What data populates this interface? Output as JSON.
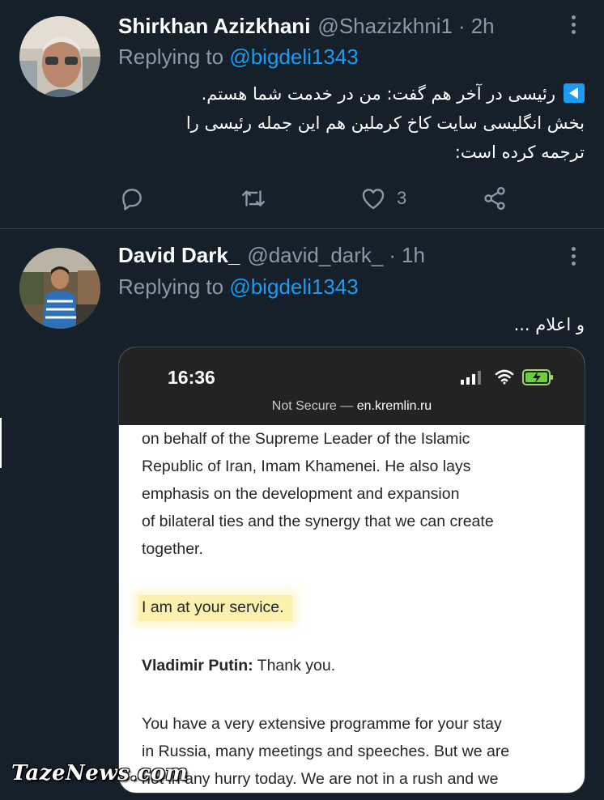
{
  "tweets": [
    {
      "name": "Shirkhan Azizkhani",
      "handle": "@Shazizkhni1",
      "separator": "·",
      "time": "2h",
      "replying_prefix": "Replying to",
      "replying_to": "@bigdeli1343",
      "text_line1": "رئیسی در آخر هم گفت: من در خدمت شما هستم.",
      "text_line2": "بخش انگلیسی سایت کاخ کرملین هم این جمله رئیسی را",
      "text_line3": "ترجمه کرده است:",
      "like_count": "3"
    },
    {
      "name": "David Dark_",
      "handle": "@david_dark_",
      "separator": "·",
      "time": "1h",
      "replying_prefix": "Replying to",
      "replying_to": "@bigdeli1343",
      "text": "و اعلام ..."
    }
  ],
  "embed": {
    "phone_time": "16:36",
    "url_prefix": "Not Secure —",
    "url_domain": "en.kremlin.ru",
    "para1_line1": "on behalf of the Supreme Leader of the Islamic",
    "para1_line2": "Republic of Iran, Imam Khamenei. He also lays",
    "para1_line3": "emphasis on the development and expansion",
    "para1_line4": "of bilateral ties and the synergy that we can create",
    "para1_line5": "together.",
    "highlight": "I am at your service.",
    "speaker": "Vladimir Putin:",
    "speaker_line": " Thank you.",
    "para3_line1": "You have a very extensive programme for your stay",
    "para3_line2": "in Russia, many meetings and speeches. But we are",
    "para3_line3": "not in any hurry today. We are not in a rush and we"
  },
  "watermark": "TazeNews.com",
  "colors": {
    "background": "#15202b",
    "accent": "#1d9bf0",
    "muted": "#8b98a5",
    "divider": "#38444d"
  },
  "icons": [
    "reply-icon",
    "retweet-icon",
    "like-icon",
    "share-icon",
    "more-icon",
    "signal-icon",
    "wifi-icon",
    "battery-icon"
  ]
}
